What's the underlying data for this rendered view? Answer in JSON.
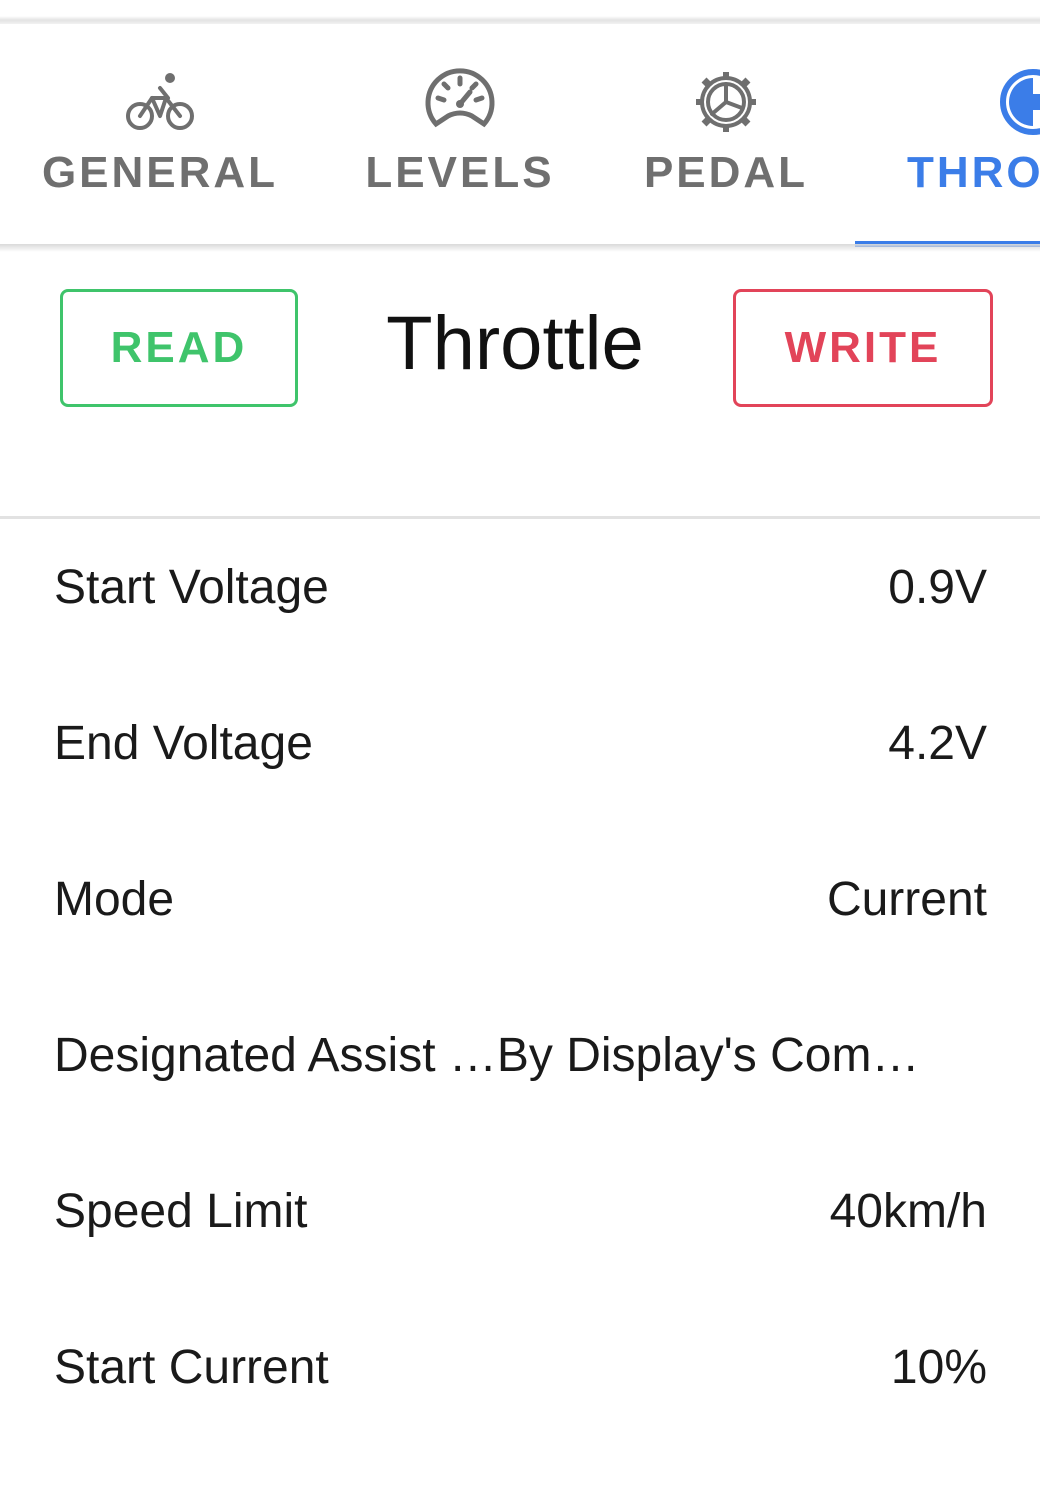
{
  "tabs": [
    {
      "label": "GENERAL",
      "icon": "bicycle-icon",
      "active": false
    },
    {
      "label": "LEVELS",
      "icon": "speedometer-icon",
      "active": false
    },
    {
      "label": "PEDAL",
      "icon": "pedal-gear-icon",
      "active": false
    },
    {
      "label": "THROT",
      "icon": "throttle-icon",
      "active": true
    }
  ],
  "toolbar": {
    "read_label": "READ",
    "title": "Throttle",
    "write_label": "WRITE"
  },
  "settings": [
    {
      "label": "Start Voltage",
      "value": "0.9V"
    },
    {
      "label": "End Voltage",
      "value": "4.2V"
    },
    {
      "label": "Mode",
      "value": "Current"
    },
    {
      "text": "Designated Assist …By Display's Com…"
    },
    {
      "label": "Speed Limit",
      "value": "40km/h"
    },
    {
      "label": "Start Current",
      "value": "10%"
    }
  ],
  "colors": {
    "active_tab": "#3b7de8",
    "inactive_tab": "#6f6f6f",
    "read_button": "#3fc46b",
    "write_button": "#e24459"
  }
}
